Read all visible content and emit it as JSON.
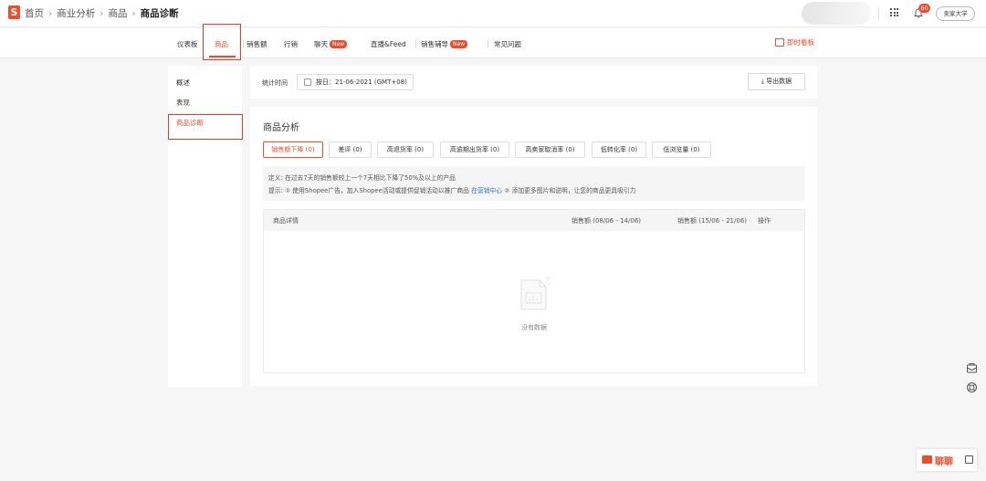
{
  "breadcrumb": {
    "logo_text": "S",
    "home": "首页",
    "level1": "商业分析",
    "level2": "商品",
    "current": "商品诊断",
    "separator": "›"
  },
  "header": {
    "notification_count": "60",
    "university_label": "卖家大学"
  },
  "nav": {
    "items": [
      {
        "label": "仪表板"
      },
      {
        "label": "商品"
      },
      {
        "label": "销售额"
      },
      {
        "label": "行销"
      },
      {
        "label": "聊天",
        "badge": "New"
      },
      {
        "label": "直播&Feed"
      },
      {
        "label": "销售辅导",
        "badge": "New"
      },
      {
        "label": "常见问题"
      }
    ],
    "realtime_label": "即时看板"
  },
  "left_menu": {
    "items": [
      {
        "label": "概述"
      },
      {
        "label": "表现"
      },
      {
        "label": "商品诊断"
      }
    ]
  },
  "time_filter": {
    "label": "统计时间",
    "value": "按日：21-06-2021 (GMT+08)",
    "export_label": "导出数据"
  },
  "analysis": {
    "title": "商品分析",
    "chips": [
      {
        "label": "销售额下降 (0)"
      },
      {
        "label": "差评 (0)"
      },
      {
        "label": "高退货率 (0)"
      },
      {
        "label": "高逾期出货率 (0)"
      },
      {
        "label": "高卖家取消率 (0)"
      },
      {
        "label": "低转化率 (0)"
      },
      {
        "label": "低浏览量 (0)"
      }
    ],
    "definition": "定义: 在过去7天的销售额较上一个7天相比下降了50%及以上的产品",
    "tip_prefix": "提示: ① 使用Shopee广告，加入Shopee活动或提供促销活动以推广商品",
    "tip_link": "在营销中心",
    "tip_suffix": "② 添加更多图片和说明，让您的商品更具吸引力",
    "table": {
      "col_detail": "商品详情",
      "col_sales_prev": "销售额 (08/06 - 14/06)",
      "col_sales_curr": "销售额 (15/06 - 21/06)",
      "col_action": "操作",
      "empty_text": "没有数据"
    }
  },
  "chat": {
    "label": "聊聊"
  },
  "colors": {
    "accent": "#ee4d2d",
    "link": "#2673dd",
    "highlight_box": "#e03a2f"
  }
}
